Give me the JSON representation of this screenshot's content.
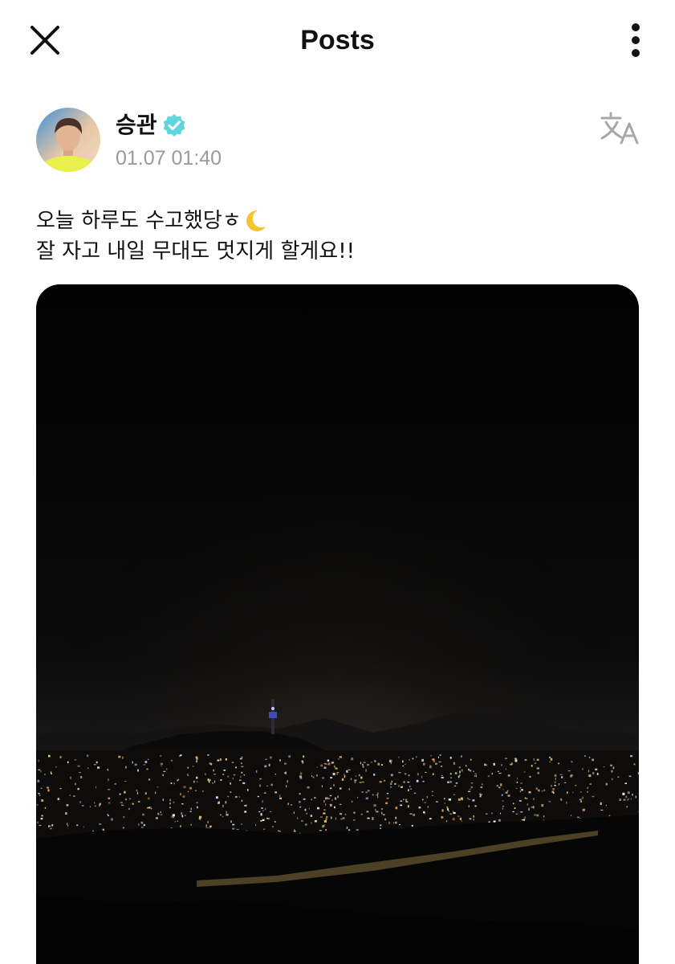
{
  "header": {
    "title": "Posts",
    "close_icon": "close-icon",
    "more_icon": "more-vertical-icon"
  },
  "author": {
    "name": "승관",
    "verified_icon": "verified-badge-icon",
    "verified_color": "#5ed6df",
    "timestamp": "01.07 01:40",
    "translate_icon": "translate-icon"
  },
  "post": {
    "line1": "오늘 하루도 수고했당ㅎ",
    "line1_emoji": "crescent-moon-icon",
    "line2": "잘 자고 내일 무대도 멋지게 할게요!!"
  },
  "colors": {
    "text": "#111111",
    "muted": "#9a9a9a",
    "photo_bg": "#000000"
  }
}
